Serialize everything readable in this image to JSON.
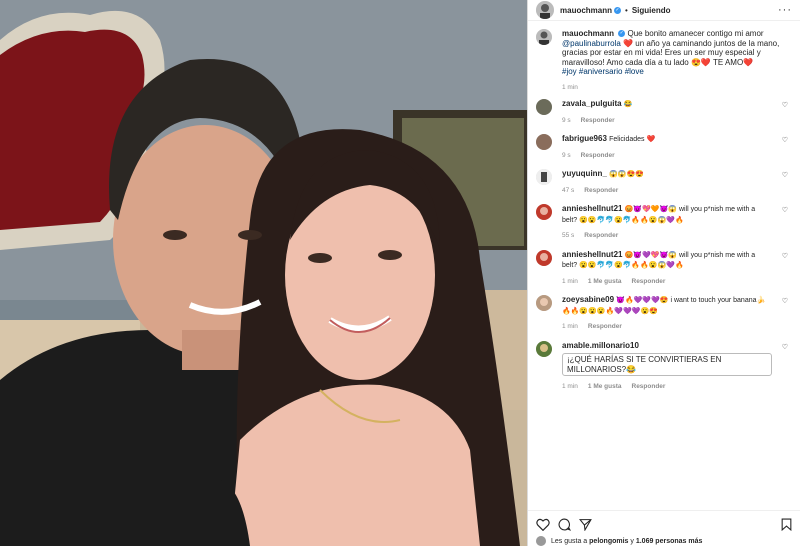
{
  "post": {
    "username": "mauochmann",
    "status_sep": "•",
    "follow_label": "Siguiendo",
    "more_label": "···",
    "caption": {
      "username": "mauochmann",
      "text_1": "Que bonito amanecer contigo mi amor",
      "mention": "@paulinaburrola",
      "text_2": "❤️ un año ya caminando juntos de la mano, gracias por estar en mi vida! Eres un ser muy especial y maravilloso! Amo cada día a tu lado 😍❤️ TE AMO❤️",
      "hashtags": "#joy #aniversario #love",
      "time": "1 min"
    }
  },
  "comments": [
    {
      "user": "zavala_pulguita",
      "text": "😂",
      "time": "9 s",
      "likes": "",
      "reply": "Responder"
    },
    {
      "user": "fabrigue963",
      "text": "Felicidades ❤️",
      "time": "9 s",
      "likes": "",
      "reply": "Responder"
    },
    {
      "user": "yuyuquinn_",
      "text": "😱😱😍😍",
      "time": "47 s",
      "likes": "",
      "reply": "Responder"
    },
    {
      "user": "annieshellnut21",
      "text": "😡😈💖🧡😈😱 will you p*nish me with a belt? 😮😮🐬🐬😮🐬🔥🔥😮😱💜🔥",
      "time": "55 s",
      "likes": "",
      "reply": "Responder"
    },
    {
      "user": "annieshellnut21",
      "text": "😡😈💜💖😈😱 will you p*nish me with a belt? 😮😮🐬🐬😮🐬🔥🔥😮😱💜🔥",
      "time": "1 min",
      "likes": "1 Me gusta",
      "reply": "Responder"
    },
    {
      "user": "zoeysabine09",
      "text": "😈🔥💜💜💜😍 i want to touch your banana🍌 🔥🔥😮😮😮🔥💜💜💜😮😍",
      "time": "1 min",
      "likes": "",
      "reply": "Responder"
    },
    {
      "user": "amable.millonario10",
      "text": "¡¿QUÉ HARÍAS SI TE CONVIRTIERAS EN MILLONARIOS?😂",
      "time": "1 min",
      "likes": "1 Me gusta",
      "reply": "Responder"
    }
  ],
  "likes_line": {
    "prefix": "Les gusta a",
    "user": "pelongomis",
    "connector": "y",
    "count": "1.069 personas más"
  },
  "icons": [
    "heart-icon",
    "comment-icon",
    "share-icon",
    "bookmark-icon",
    "verified-icon",
    "more-icon"
  ],
  "colors": {
    "link": "#00376b",
    "verified": "#3897f0",
    "meta": "#8e8e8e",
    "heart": "#ed4956"
  }
}
